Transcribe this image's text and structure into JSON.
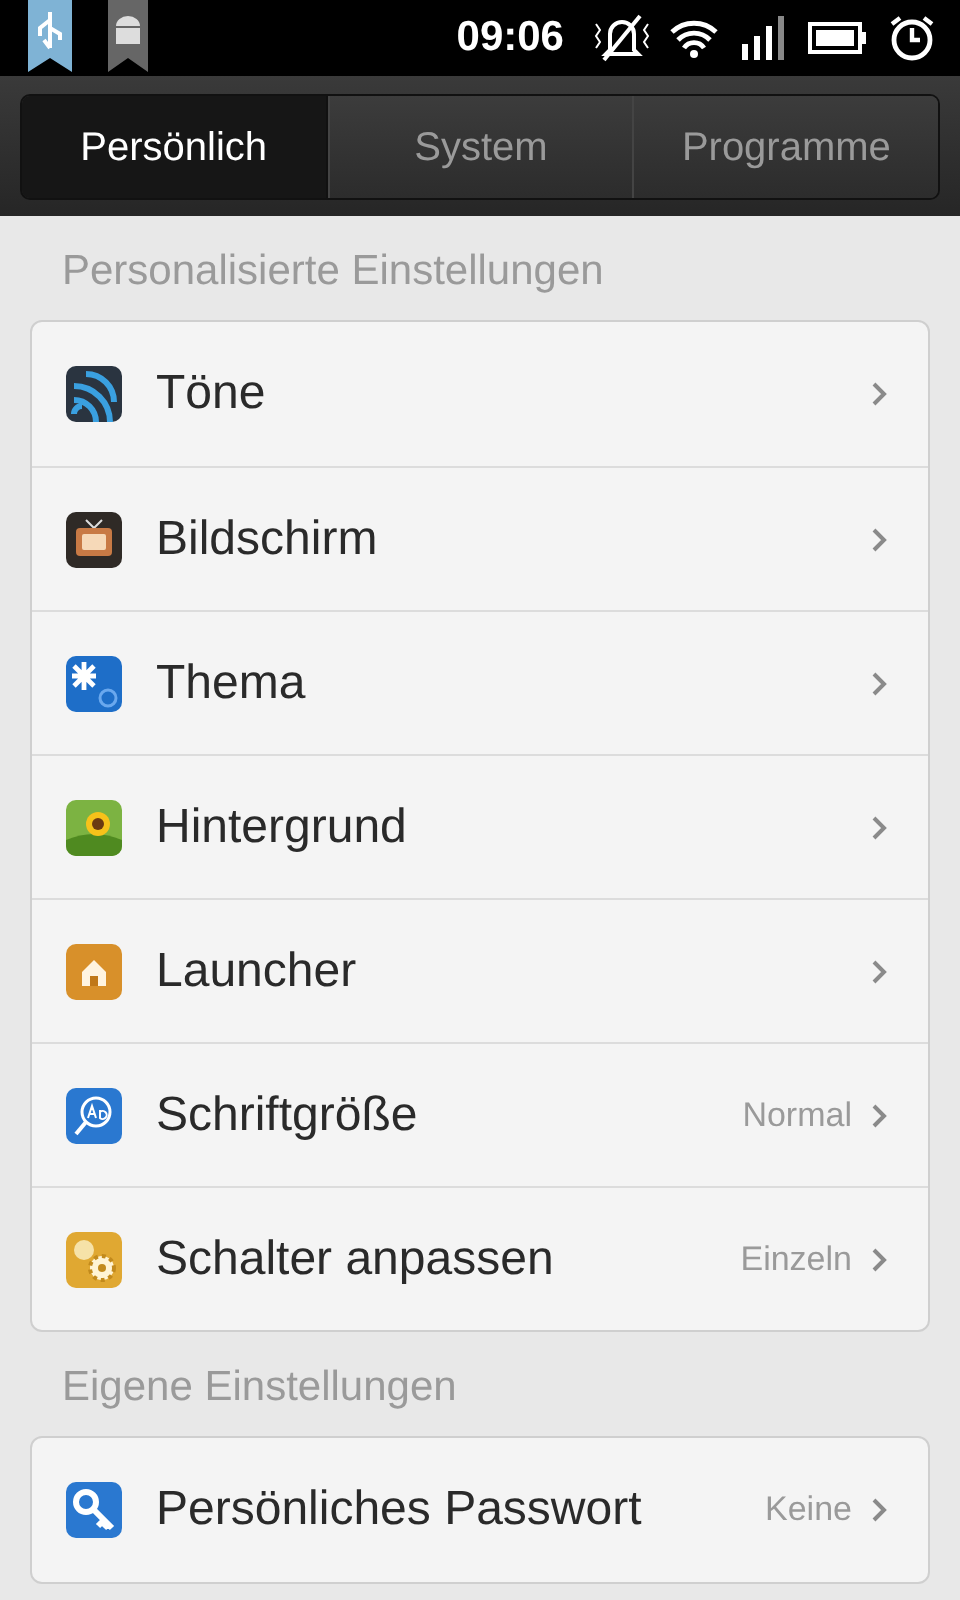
{
  "status_bar": {
    "time": "09:06"
  },
  "tabs": [
    {
      "label": "Persönlich",
      "selected": true
    },
    {
      "label": "System",
      "selected": false
    },
    {
      "label": "Programme",
      "selected": false
    }
  ],
  "sections": [
    {
      "title": "Personalisierte Einstellungen",
      "items": [
        {
          "label": "Töne"
        },
        {
          "label": "Bildschirm"
        },
        {
          "label": "Thema"
        },
        {
          "label": "Hintergrund"
        },
        {
          "label": "Launcher"
        },
        {
          "label": "Schriftgröße",
          "value": "Normal"
        },
        {
          "label": "Schalter anpassen",
          "value": "Einzeln"
        }
      ]
    },
    {
      "title": "Eigene Einstellungen",
      "items": [
        {
          "label": "Persönliches Passwort",
          "value": "Keine"
        }
      ]
    }
  ]
}
